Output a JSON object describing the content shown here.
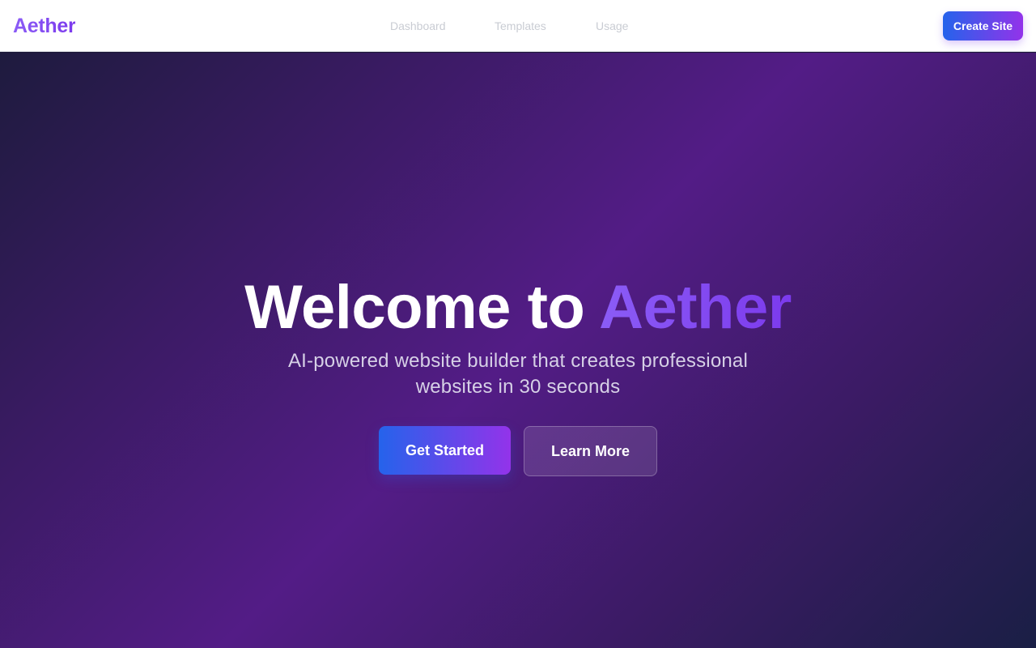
{
  "header": {
    "brand": "Aether",
    "nav": [
      {
        "label": "Dashboard"
      },
      {
        "label": "Templates"
      },
      {
        "label": "Usage"
      }
    ],
    "cta_label": "Create Site"
  },
  "hero": {
    "title_prefix": "Welcome to ",
    "title_accent": "Aether",
    "subtitle": "AI-powered website builder that creates professional websites in 30 seconds",
    "primary_button": "Get Started",
    "secondary_button": "Learn More"
  },
  "colors": {
    "brand_accent": "#8b5cf6",
    "gradient_start": "#2563eb",
    "gradient_end": "#9333ea",
    "hero_dark": "#1e1b3e",
    "hero_purple": "#531c86",
    "nav_text": "#c9ccd3"
  }
}
